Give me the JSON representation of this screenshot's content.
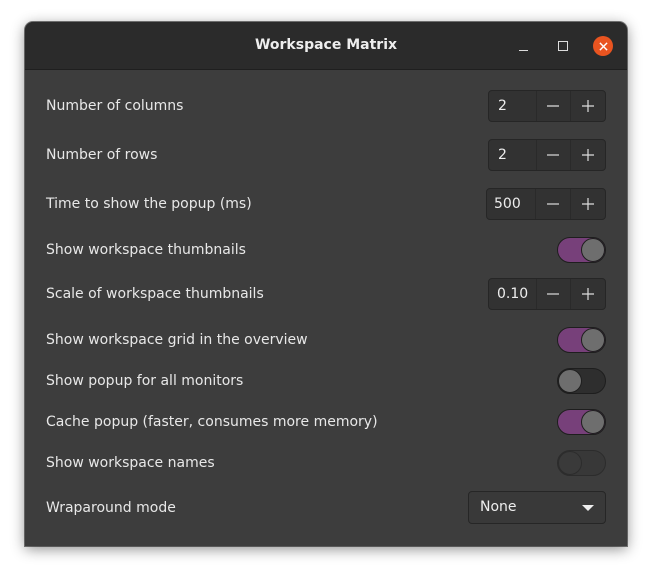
{
  "window": {
    "title": "Workspace Matrix",
    "controls": [
      "minimize",
      "maximize",
      "close"
    ],
    "close_color": "#e95420"
  },
  "settings": {
    "columns": {
      "label": "Number of columns",
      "value": "2",
      "minus": "−",
      "plus": "+"
    },
    "rows": {
      "label": "Number of rows",
      "value": "2",
      "minus": "−",
      "plus": "+"
    },
    "popup_time": {
      "label": "Time to show the popup (ms)",
      "value": "500",
      "minus": "−",
      "plus": "+"
    },
    "show_thumbnails": {
      "label": "Show workspace thumbnails",
      "state": "on"
    },
    "thumbnail_scale": {
      "label": "Scale of workspace thumbnails",
      "value": "0.10",
      "minus": "−",
      "plus": "+"
    },
    "show_grid_overview": {
      "label": "Show workspace grid in the overview",
      "state": "on"
    },
    "popup_all_monitors": {
      "label": "Show popup for all monitors",
      "state": "off"
    },
    "cache_popup": {
      "label": "Cache popup (faster, consumes more memory)",
      "state": "on"
    },
    "show_names": {
      "label": "Show workspace names",
      "state": "off",
      "disabled": true
    },
    "wraparound": {
      "label": "Wraparound mode",
      "selected": "None"
    }
  },
  "colors": {
    "accent": "#77407a",
    "background": "#3d3d3d",
    "titlebar": "#2b2b2b"
  }
}
